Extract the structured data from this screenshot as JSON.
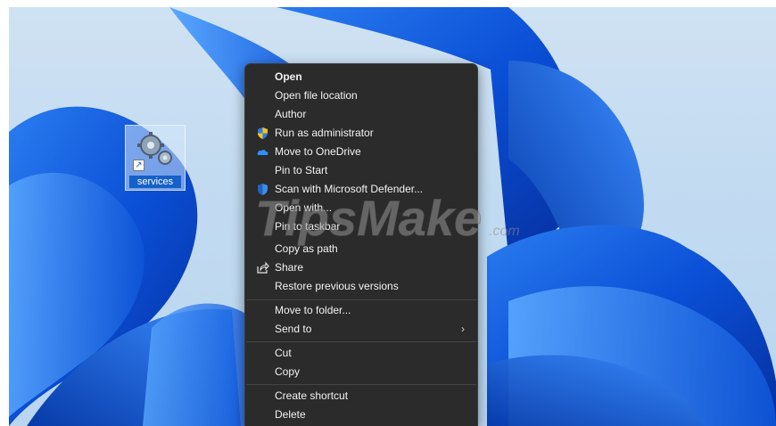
{
  "desktop": {
    "icon": {
      "name": "services",
      "icon": "gears-icon"
    }
  },
  "context_menu": {
    "items": [
      {
        "label": "Open",
        "icon": ""
      },
      {
        "label": "Open file location",
        "icon": ""
      },
      {
        "label": "Author",
        "icon": ""
      },
      {
        "label": "Run as administrator",
        "icon": "uac-shield-icon"
      },
      {
        "label": "Move to OneDrive",
        "icon": "onedrive-cloud-icon"
      },
      {
        "label": "Pin to Start",
        "icon": ""
      },
      {
        "label": "Scan with Microsoft Defender...",
        "icon": "defender-shield-icon"
      },
      {
        "label": "Open with...",
        "icon": ""
      },
      {
        "label": "Pin to taskbar",
        "icon": ""
      },
      {
        "label": "Copy as path",
        "icon": ""
      },
      {
        "label": "Share",
        "icon": "share-icon"
      },
      {
        "label": "Restore previous versions",
        "icon": ""
      },
      {
        "label": "Move to folder...",
        "icon": ""
      },
      {
        "label": "Send to",
        "icon": "",
        "submenu_arrow": "›"
      },
      {
        "label": "Cut",
        "icon": ""
      },
      {
        "label": "Copy",
        "icon": ""
      },
      {
        "label": "Create shortcut",
        "icon": ""
      },
      {
        "label": "Delete",
        "icon": ""
      }
    ]
  },
  "watermark": {
    "text": "TipsMake",
    "suffix": ".com"
  },
  "colors": {
    "menu_bg": "#2b2b2b",
    "menu_text": "#f2f2f2",
    "separator": "#444444",
    "selection_blue": "#1560c9",
    "wallpaper_blue": "#0a4fd6"
  }
}
